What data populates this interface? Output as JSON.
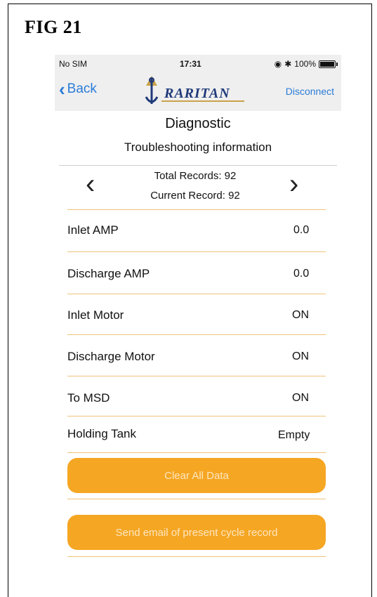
{
  "figure": {
    "label": "FIG 21"
  },
  "status_bar": {
    "carrier": "No SIM",
    "time": "17:31",
    "battery": "100%"
  },
  "nav": {
    "back_label": "Back",
    "logo_text": "RARITAN",
    "disconnect_label": "Disconnect"
  },
  "page": {
    "title": "Diagnostic",
    "subtitle": "Troubleshooting information"
  },
  "records": {
    "total": "Total Records: 92",
    "current": "Current Record: 92"
  },
  "rows": [
    {
      "label": "Inlet AMP",
      "value": "0.0"
    },
    {
      "label": "Discharge AMP",
      "value": "0.0"
    },
    {
      "label": "Inlet Motor",
      "value": "ON"
    },
    {
      "label": "Discharge Motor",
      "value": "ON"
    },
    {
      "label": "To MSD",
      "value": "ON"
    },
    {
      "label": "Holding Tank",
      "value": "Empty"
    }
  ],
  "buttons": {
    "clear_all": "Clear All Data",
    "send_email": "Send email of present cycle record"
  },
  "colors": {
    "accent_orange": "#f5a623",
    "link_blue": "#2b7cd9",
    "divider": "#f0c27a"
  }
}
